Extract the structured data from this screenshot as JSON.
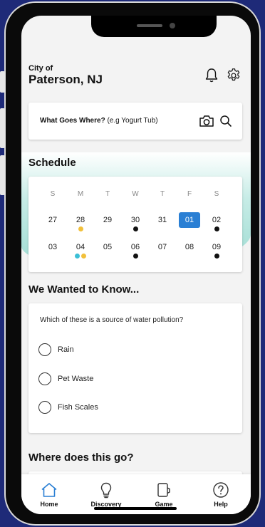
{
  "header": {
    "city_label": "City of",
    "city_name": "Paterson, NJ"
  },
  "icons": {
    "notifications": "bell-icon",
    "settings": "gear-icon",
    "camera": "camera-icon",
    "search": "search-icon"
  },
  "search": {
    "label_bold": "What Goes Where?",
    "placeholder": "(e.g Yogurt Tub)"
  },
  "schedule": {
    "title": "Schedule",
    "weekdays": [
      "S",
      "M",
      "T",
      "W",
      "T",
      "F",
      "S"
    ],
    "weeks": [
      [
        {
          "day": "27",
          "dots": []
        },
        {
          "day": "28",
          "dots": [
            "#f2c03a"
          ]
        },
        {
          "day": "29",
          "dots": []
        },
        {
          "day": "30",
          "dots": [
            "#111111"
          ]
        },
        {
          "day": "31",
          "dots": []
        },
        {
          "day": "01",
          "dots": [],
          "selected": true
        },
        {
          "day": "02",
          "dots": [
            "#111111"
          ]
        }
      ],
      [
        {
          "day": "03",
          "dots": []
        },
        {
          "day": "04",
          "dots": [
            "#3bbfd6",
            "#f2c03a"
          ]
        },
        {
          "day": "05",
          "dots": []
        },
        {
          "day": "06",
          "dots": [
            "#111111"
          ]
        },
        {
          "day": "07",
          "dots": []
        },
        {
          "day": "08",
          "dots": []
        },
        {
          "day": "09",
          "dots": [
            "#111111"
          ]
        }
      ]
    ],
    "selected_color": "#2a7fd4"
  },
  "quiz": {
    "title": "We Wanted to Know...",
    "question": "Which of these is a source of water pollution?",
    "options": [
      "Rain",
      "Pet Waste",
      "Fish Scales"
    ]
  },
  "next_section": {
    "title": "Where does this go?"
  },
  "tabbar": {
    "tabs": [
      {
        "label": "Home",
        "icon": "home-icon",
        "active": true
      },
      {
        "label": "Discovery",
        "icon": "lightbulb-icon"
      },
      {
        "label": "Game",
        "icon": "game-icon"
      },
      {
        "label": "Help",
        "icon": "help-icon"
      }
    ]
  },
  "colors": {
    "accent": "#2a7fd4",
    "teal": "#9edbd2",
    "home_icon": "#2a7fd4"
  }
}
